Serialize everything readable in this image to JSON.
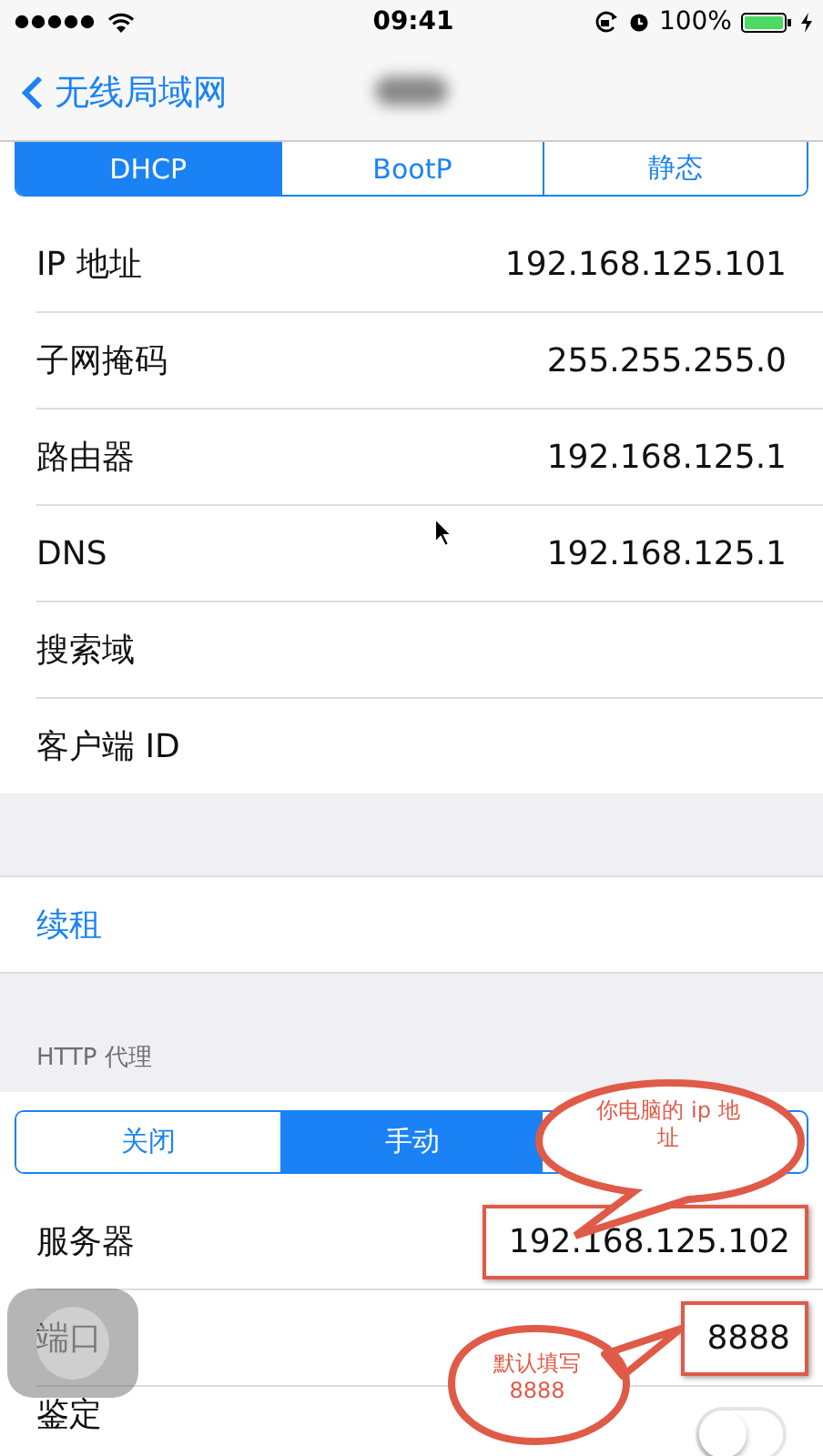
{
  "status_bar": {
    "time": "09:41",
    "battery": "100%"
  },
  "nav": {
    "back": "无线局域网"
  },
  "ip_modes": [
    {
      "label": "DHCP",
      "selected": true
    },
    {
      "label": "BootP",
      "selected": false
    },
    {
      "label": "静态",
      "selected": false
    }
  ],
  "dhcp_rows": [
    {
      "label": "IP 地址",
      "value": "192.168.125.101"
    },
    {
      "label": "子网掩码",
      "value": "255.255.255.0"
    },
    {
      "label": "路由器",
      "value": "192.168.125.1"
    },
    {
      "label": "DNS",
      "value": "192.168.125.1"
    },
    {
      "label": "搜索域"
    },
    {
      "label": "客户端 ID"
    }
  ],
  "renew": {
    "label": "续租"
  },
  "http_proxy": {
    "header": "HTTP 代理",
    "modes": [
      {
        "label": "关闭",
        "selected": false
      },
      {
        "label": "手动",
        "selected": true
      }
    ],
    "rows": [
      {
        "kind": "field",
        "label": "服务器",
        "value": "192.168.125.102",
        "highlighted": true
      },
      {
        "kind": "field",
        "label": "端口",
        "value": "8888",
        "highlighted": true
      },
      {
        "kind": "switch",
        "label": "鉴定",
        "on": false
      }
    ]
  },
  "annotations": [
    {
      "text": "你电脑的 ip 地址"
    },
    {
      "text": "默认填写 8888"
    }
  ]
}
